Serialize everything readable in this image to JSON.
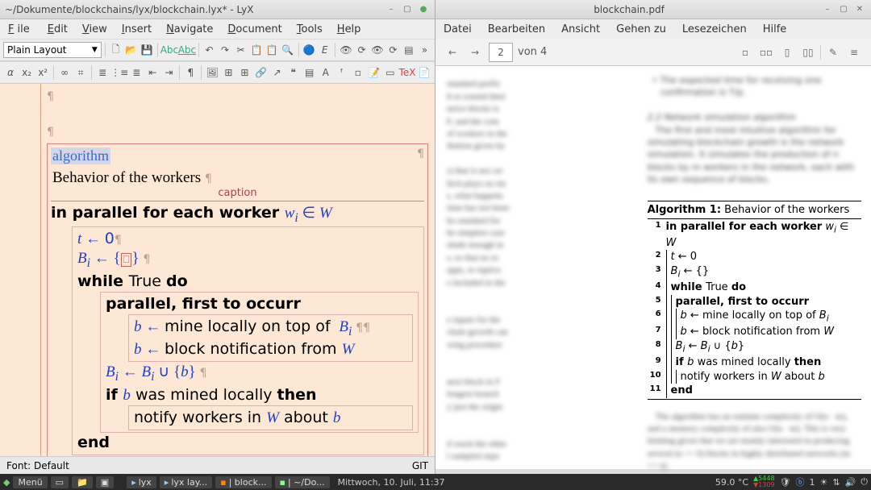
{
  "lyx": {
    "titlebar": "~/Dokumente/blockchains/lyx/blockchain.lyx* - LyX",
    "menu": {
      "file": "File",
      "edit": "Edit",
      "view": "View",
      "insert": "Insert",
      "navigate": "Navigate",
      "document": "Document",
      "tools": "Tools",
      "help": "Help"
    },
    "layout_combo": "Plain Layout",
    "status_left": "Font: Default",
    "status_right": "GIT",
    "icons": {
      "new": "🗋",
      "open": "📂",
      "save": "💾",
      "spell": "✔",
      "undo": "↶",
      "redo": "↷",
      "cut": "✂",
      "copy": "📋",
      "paste": "📋",
      "find": "🔍",
      "nav": "🔵",
      "pdf": "👁",
      "update": "⟳",
      "more": "»",
      "math": "Σ",
      "sqrt": "√",
      "frac": "⅟",
      "sum": "∑",
      "int": "∫",
      "list_bul": "•",
      "list_num": "≡",
      "indent_l": "⇤",
      "indent_r": "⇥",
      "par": "¶",
      "fig": "🖼",
      "tab": "⊞",
      "link": "🔗",
      "note": "📝",
      "box": "▭",
      "ref": "↗",
      "cite": "❝",
      "idx": "▤",
      "ert": "T",
      "foot": "ᵃ"
    }
  },
  "pdfapp": {
    "titlebar": "blockchain.pdf",
    "menu": {
      "datei": "Datei",
      "bearbeiten": "Bearbeiten",
      "ansicht": "Ansicht",
      "gehenzu": "Gehen zu",
      "lesezeichen": "Lesezeichen",
      "hilfe": "Hilfe"
    },
    "page_current": "2",
    "page_total": "von 4",
    "nav_prev": "←",
    "nav_next": "→",
    "view_icons": {
      "single": "▫",
      "facing": "▫▫",
      "cont": "▯",
      "cont2": "▯▯",
      "sep": "|",
      "annot": "✎",
      "menu": "☰"
    }
  },
  "algo": {
    "float_label": "algorithm",
    "caption_text": "Behavior of the workers ",
    "caption_label": "caption",
    "line1_pre": "in parallel for each worker ",
    "line1_w": "w",
    "line1_sub": "i",
    "line1_in": " ∈ ",
    "line1_set": "W",
    "l2": "t ← 0",
    "l3a": "B",
    "l3sub": "i",
    "l3b": " ← {",
    "l3box": "⎕",
    "l3c": "} ",
    "l4_while": "while ",
    "l4_true": "True ",
    "l4_do": "do",
    "l5": "parallel, first to occurr",
    "l6a": "b ← ",
    "l6b": "mine locally on top of ",
    "l6c": "B",
    "l6sub": "i",
    "l7a": "b ← ",
    "l7b": "block notification from ",
    "l7c": "W",
    "l8a": "B",
    "l8sub1": "i",
    "l8b": " ← B",
    "l8sub2": "i",
    "l8c": " ∪ {b} ",
    "l9a": "if ",
    "l9b": "b",
    "l9c": " was mined locally ",
    "l9d": "then",
    "l10a": "notify workers in ",
    "l10b": "W",
    "l10c": " about ",
    "l10d": "b",
    "l11": "end",
    "pilcrow": "¶"
  },
  "pdf_algo": {
    "title_label": "Algorithm 1:",
    "title_text": " Behavior of the workers",
    "lines": {
      "1": "in parallel for each worker",
      "1m": "wᵢ ∈ W",
      "2": "t ← 0",
      "3": "Bᵢ ← {}",
      "4w": "while ",
      "4t": "True ",
      "4d": "do",
      "5": "parallel, first to occurr",
      "6": "b ← mine locally on top of Bᵢ",
      "7": "b ← block notification from W",
      "8": "Bᵢ ← Bᵢ ∪ {b}",
      "9a": "if ",
      "9b": "b",
      "9c": " was mined locally ",
      "9d": "then",
      "10": "notify workers in W about b",
      "11": "end"
    }
  },
  "taskbar": {
    "menu": "Menü",
    "items": {
      "lyx": "lyx",
      "lyxlay": "lyx lay...",
      "block": "| block...",
      "dok": "| ~/Do..."
    },
    "datetime": "Mittwoch, 10. Juli, 11:37",
    "temp": "59.0 °C",
    "net": "↑ 5448\n↓ 1309",
    "tray_icons": [
      "🛡",
      "ⓘ",
      "1",
      "☁",
      "🔊",
      "⏻"
    ]
  },
  "blur_filler": {
    "p1": "The first and most intuitive algorithm for simulating blockchain growth is the network simulation. It simulates the production of n blocks by m workers in the network, each with its own sequence of blocks.",
    "p2": "The algorithm has an runtime complexity of O(n · m), and a memory complexity of also O(n · m). This is very limiting given that we are mainly interested in producing several (n >> 0) blocks in highly distributed networks (m >> n).",
    "h": "2.2 Network simulation algorithm",
    "bullet": "• The expected time for receiving one confirmation is T/p."
  }
}
